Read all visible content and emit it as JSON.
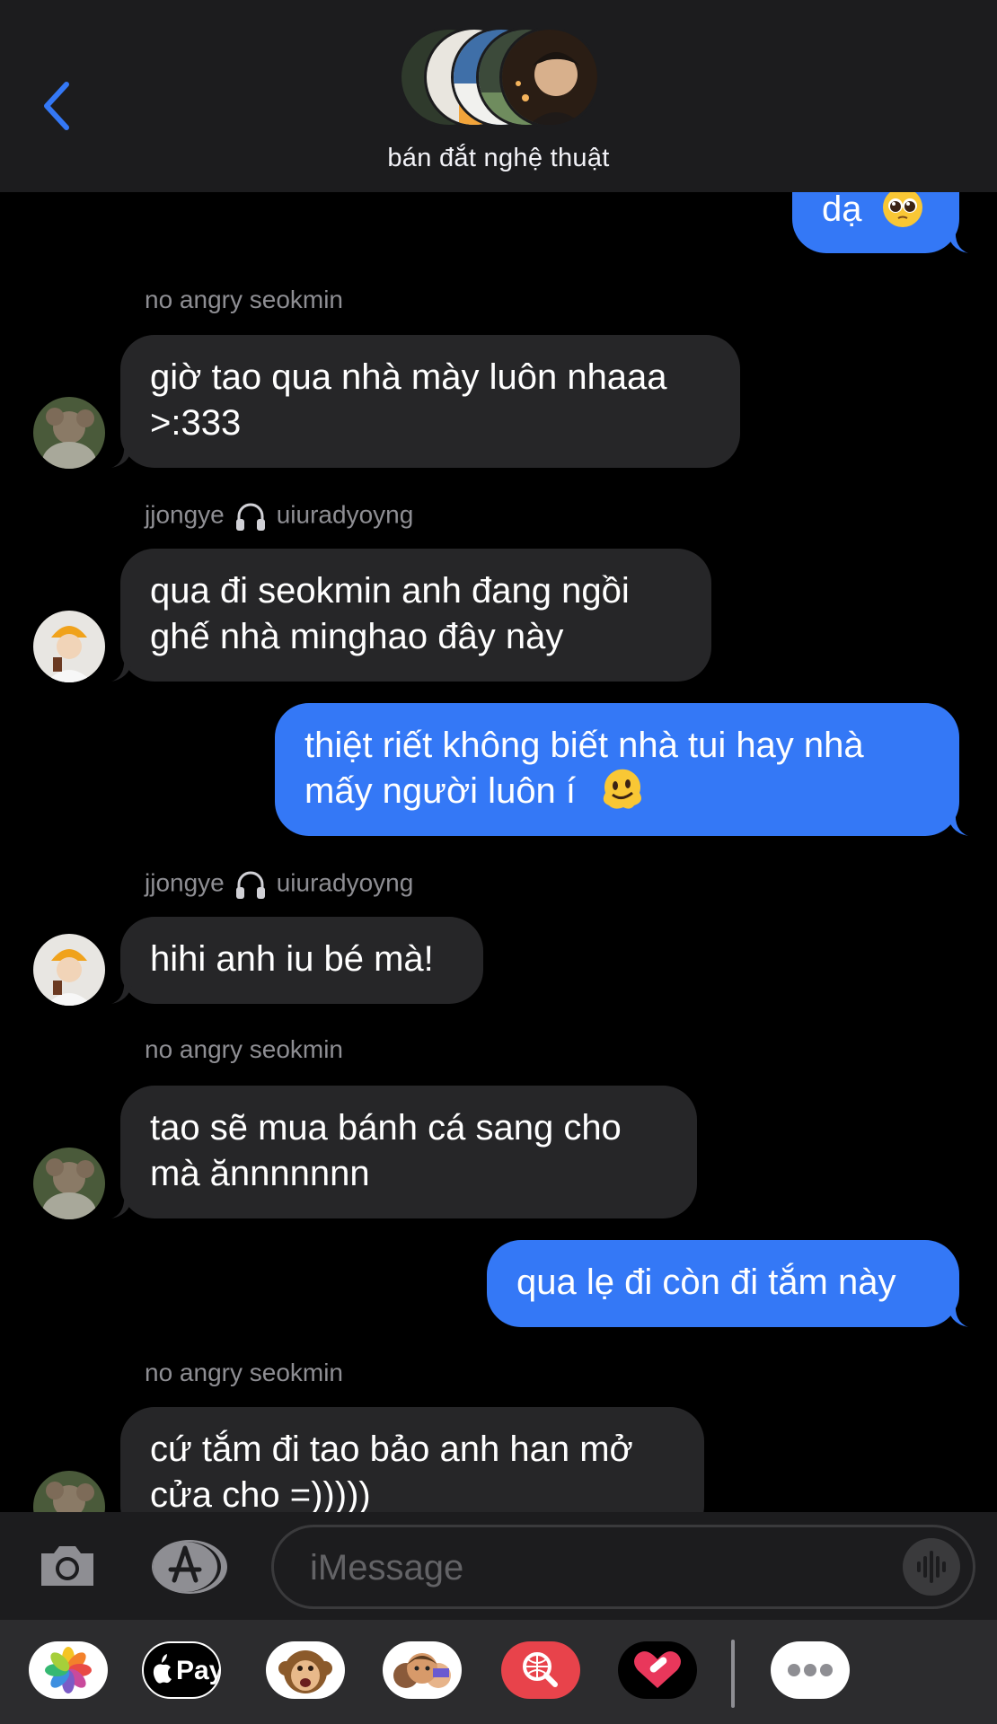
{
  "header": {
    "group_name": "bán đắt nghệ thuật",
    "back_icon": "chevron-left-icon"
  },
  "messages": [
    {
      "type": "out",
      "text": "dạ",
      "emoji": "pleading-face"
    },
    {
      "type": "sender",
      "name": "no angry seokmin"
    },
    {
      "type": "in",
      "lines": [
        "giờ tao qua nhà mày luôn nhaaa",
        ">:333"
      ]
    },
    {
      "type": "sender",
      "name": "jjongye",
      "icon": "headphones-icon",
      "name2": "uiuradyoyng"
    },
    {
      "type": "in",
      "lines": [
        "qua đi seokmin anh đang ngồi",
        "ghế nhà minghao đây này"
      ]
    },
    {
      "type": "out",
      "lines": [
        "thiệt riết không biết nhà tui hay nhà",
        "mấy người luôn í"
      ],
      "emoji": "melting-face"
    },
    {
      "type": "sender",
      "name": "jjongye",
      "icon": "headphones-icon",
      "name2": "uiuradyoyng"
    },
    {
      "type": "in",
      "text": "hihi anh iu bé mà!"
    },
    {
      "type": "sender",
      "name": "no angry seokmin"
    },
    {
      "type": "in",
      "lines": [
        "tao sẽ mua bánh cá sang cho",
        "mà ănnnnnnn"
      ]
    },
    {
      "type": "out",
      "text": "qua lẹ đi còn đi tắm này"
    },
    {
      "type": "sender",
      "name": "no angry seokmin"
    },
    {
      "type": "in",
      "lines": [
        "cứ tắm đi tao bảo anh han mở",
        "cửa cho =)))))"
      ]
    }
  ],
  "composer": {
    "placeholder": "iMessage",
    "camera_icon": "camera-icon",
    "appstore_icon": "app-store-icon",
    "audio_icon": "waveform-icon"
  },
  "drawer": {
    "apps": [
      {
        "name": "photos-icon"
      },
      {
        "name": "apple-pay-icon",
        "label": "Pay"
      },
      {
        "name": "animoji-icon"
      },
      {
        "name": "memoji-icon"
      },
      {
        "name": "images-search-icon"
      },
      {
        "name": "digital-touch-icon"
      },
      {
        "name": "more-icon"
      }
    ]
  },
  "colors": {
    "background": "#000000",
    "header": "#1c1c1e",
    "incoming_bubble": "#262628",
    "outgoing_bubble": "#3478f6",
    "sender_name": "#8e8e93",
    "accent": "#3478f6"
  }
}
